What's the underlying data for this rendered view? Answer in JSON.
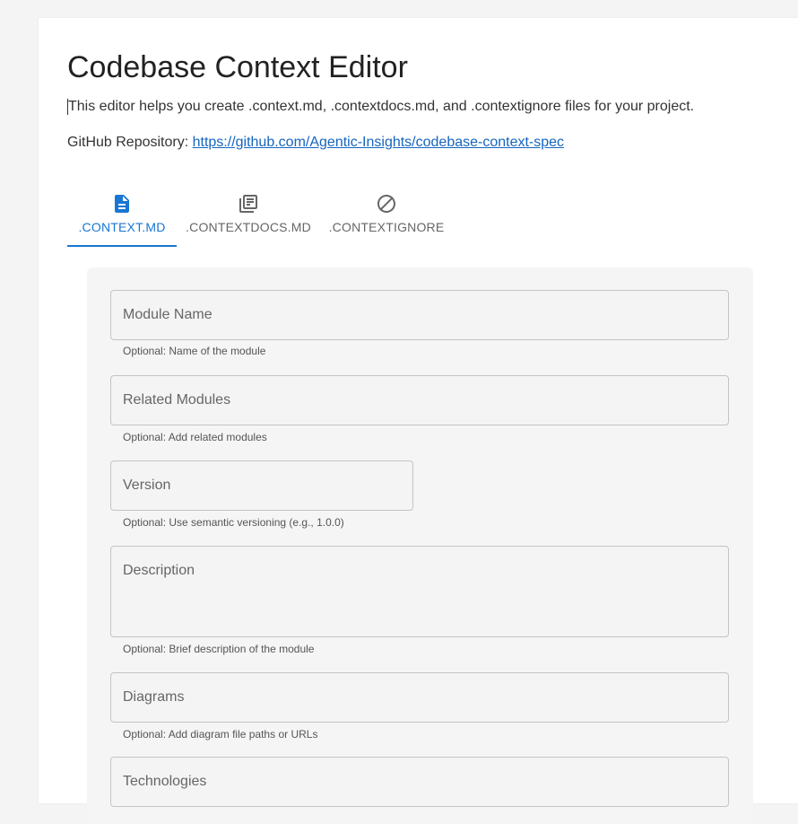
{
  "header": {
    "title": "Codebase Context Editor",
    "intro": "This editor helps you create .context.md, .contextdocs.md, and .contextignore files for your project.",
    "repo_label": "GitHub Repository: ",
    "repo_link": "https://github.com/Agentic-Insights/codebase-context-spec"
  },
  "tabs": [
    {
      "label": ".CONTEXT.MD",
      "icon": "document-icon",
      "active": true
    },
    {
      "label": ".CONTEXTDOCS.MD",
      "icon": "library-books-icon",
      "active": false
    },
    {
      "label": ".CONTEXTIGNORE",
      "icon": "block-icon",
      "active": false
    }
  ],
  "form": {
    "module_name": {
      "placeholder": "Module Name",
      "helper": "Optional: Name of the module"
    },
    "related_modules": {
      "placeholder": "Related Modules",
      "helper": "Optional: Add related modules"
    },
    "version": {
      "placeholder": "Version",
      "helper": "Optional: Use semantic versioning (e.g., 1.0.0)"
    },
    "description": {
      "placeholder": "Description",
      "helper": "Optional: Brief description of the module"
    },
    "diagrams": {
      "placeholder": "Diagrams",
      "helper": "Optional: Add diagram file paths or URLs"
    },
    "technologies": {
      "placeholder": "Technologies"
    }
  },
  "colors": {
    "accent": "#1976d2",
    "link": "#1565c0",
    "page_bg": "#f4f4f4",
    "panel_bg": "#f5f5f5"
  }
}
